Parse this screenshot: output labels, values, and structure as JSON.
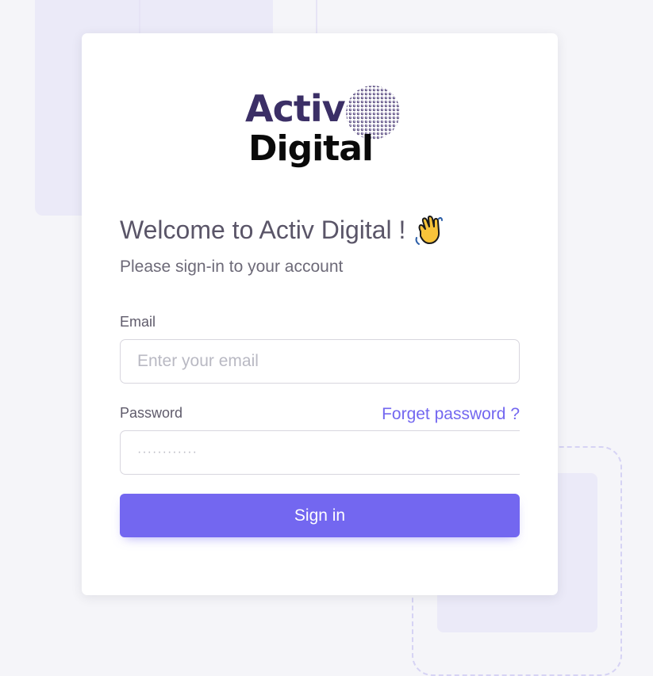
{
  "logo": {
    "line1": "Activ",
    "line2": "Digital"
  },
  "welcome": {
    "title": "Welcome to Activ Digital !",
    "icon": "waving-hand-icon",
    "subtitle": "Please sign-in to your account"
  },
  "form": {
    "email_label": "Email",
    "email_placeholder": "Enter your email",
    "email_value": "",
    "password_label": "Password",
    "password_placeholder": "············",
    "password_value": "",
    "forgot_link": "Forget password ?",
    "signin_button": "Sign in"
  },
  "colors": {
    "primary": "#7367f0",
    "background": "#f5f5f9",
    "logo_purple": "#3b2f66"
  }
}
